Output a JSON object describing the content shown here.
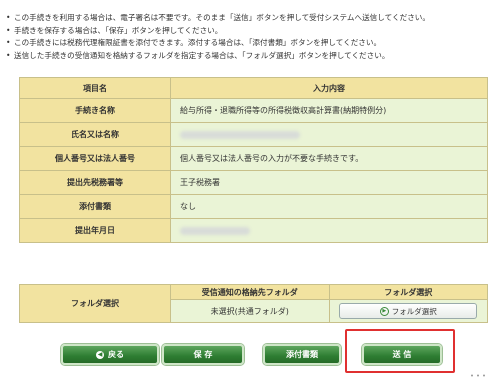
{
  "notes": [
    "この手続きを利用する場合は、電子署名は不要です。そのまま「送信」ボタンを押して受付システムへ送信してください。",
    "手続きを保存する場合は、「保存」ボタンを押してください。",
    "この手続きには税務代理権限証書を添付できます。添付する場合は、「添付書類」ボタンを押してください。",
    "送信した手続きの受信通知を格納するフォルダを指定する場合は、「フォルダ選択」ボタンを押してください。"
  ],
  "info_table": {
    "header_item": "項目名",
    "header_content": "入力内容",
    "rows": [
      {
        "label": "手続き名称",
        "value": "給与所得・退職所得等の所得税徴収高計算書(納期特例分)"
      },
      {
        "label": "氏名又は名称",
        "value": ""
      },
      {
        "label": "個人番号又は法人番号",
        "value": "個人番号又は法人番号の入力が不要な手続きです。"
      },
      {
        "label": "提出先税務署等",
        "value": "王子税務署"
      },
      {
        "label": "添付書類",
        "value": "なし"
      },
      {
        "label": "提出年月日",
        "value": ""
      }
    ]
  },
  "folder_table": {
    "label": "フォルダ選択",
    "col_storage": "受信通知の格納先フォルダ",
    "col_select": "フォルダ選択",
    "storage_value": "未選択(共通フォルダ)",
    "select_button": "フォルダ選択"
  },
  "buttons": {
    "back": "戻る",
    "save": "保 存",
    "attach": "添付書類",
    "send": "送 信"
  },
  "colors": {
    "accent_green": "#2e7d32",
    "label_bg": "#f2e3a0",
    "value_bg": "#eaf4d6",
    "highlight_red": "#e03030"
  }
}
